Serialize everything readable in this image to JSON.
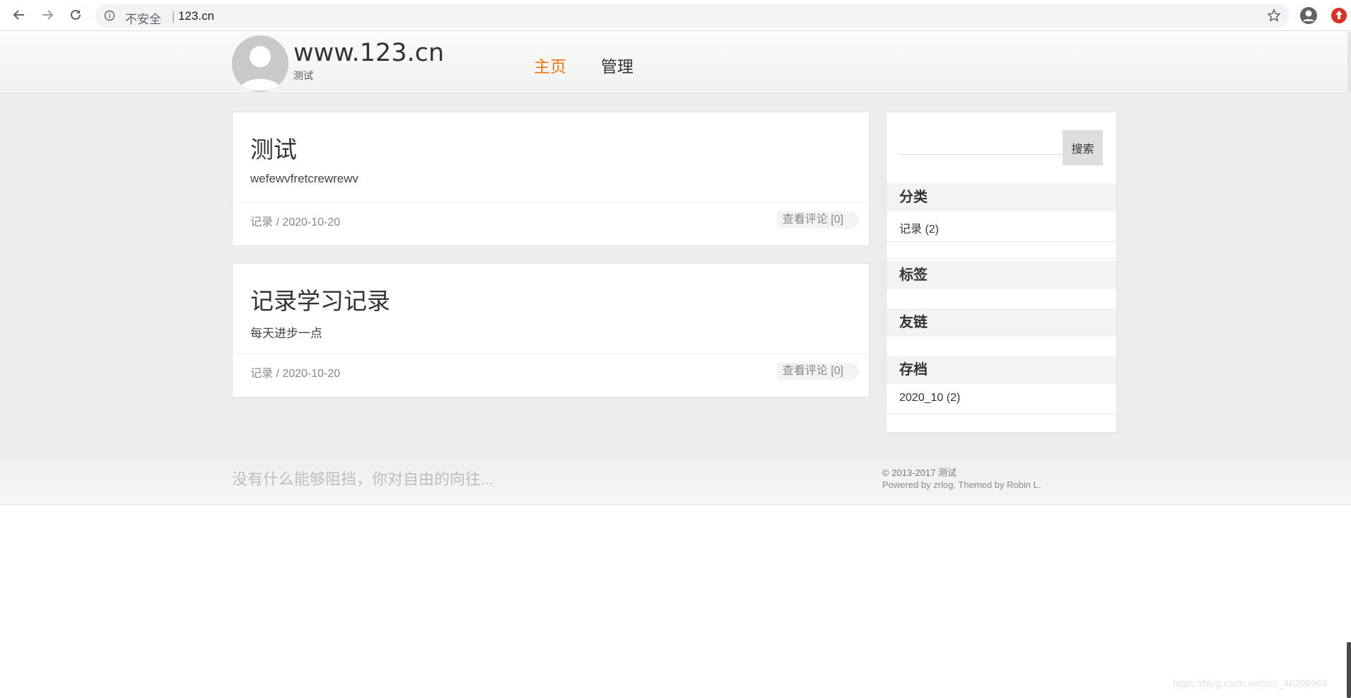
{
  "browser": {
    "security_status": "不安全",
    "separator": "|",
    "url": "123.cn",
    "icons": [
      "back-icon",
      "forward-icon",
      "reload-icon",
      "info-icon",
      "star-icon",
      "profile-icon",
      "extension-icon"
    ]
  },
  "site": {
    "title": "www.123.cn",
    "subtitle": "测试",
    "nav": [
      {
        "label": "主页",
        "active": true
      },
      {
        "label": "管理",
        "active": false
      }
    ],
    "accent_color": "#f2750c"
  },
  "posts": [
    {
      "title": "测试",
      "excerpt": "wefewvfretcrewrewv",
      "meta": "记录 / 2020-10-20",
      "comments": "查看评论 [0]"
    },
    {
      "title": "记录学习记录",
      "excerpt": "每天进步一点",
      "meta": "记录 / 2020-10-20",
      "comments": "查看评论 [0]"
    }
  ],
  "sidebar": {
    "search_value": "",
    "search_button": "搜索",
    "categories_title": "分类",
    "categories": [
      "记录 (2)"
    ],
    "tags_title": "标签",
    "links_title": "友链",
    "archive_title": "存档",
    "archives": [
      "2020_10 (2)"
    ]
  },
  "footer": {
    "motto": "没有什么能够阻挡，你对自由的向往...",
    "copyright": "© 2013-2017 测试",
    "powered": "Powered by zrlog, Themed by Robin L."
  },
  "watermark": "https://blog.csdn.net/m0_46396964"
}
